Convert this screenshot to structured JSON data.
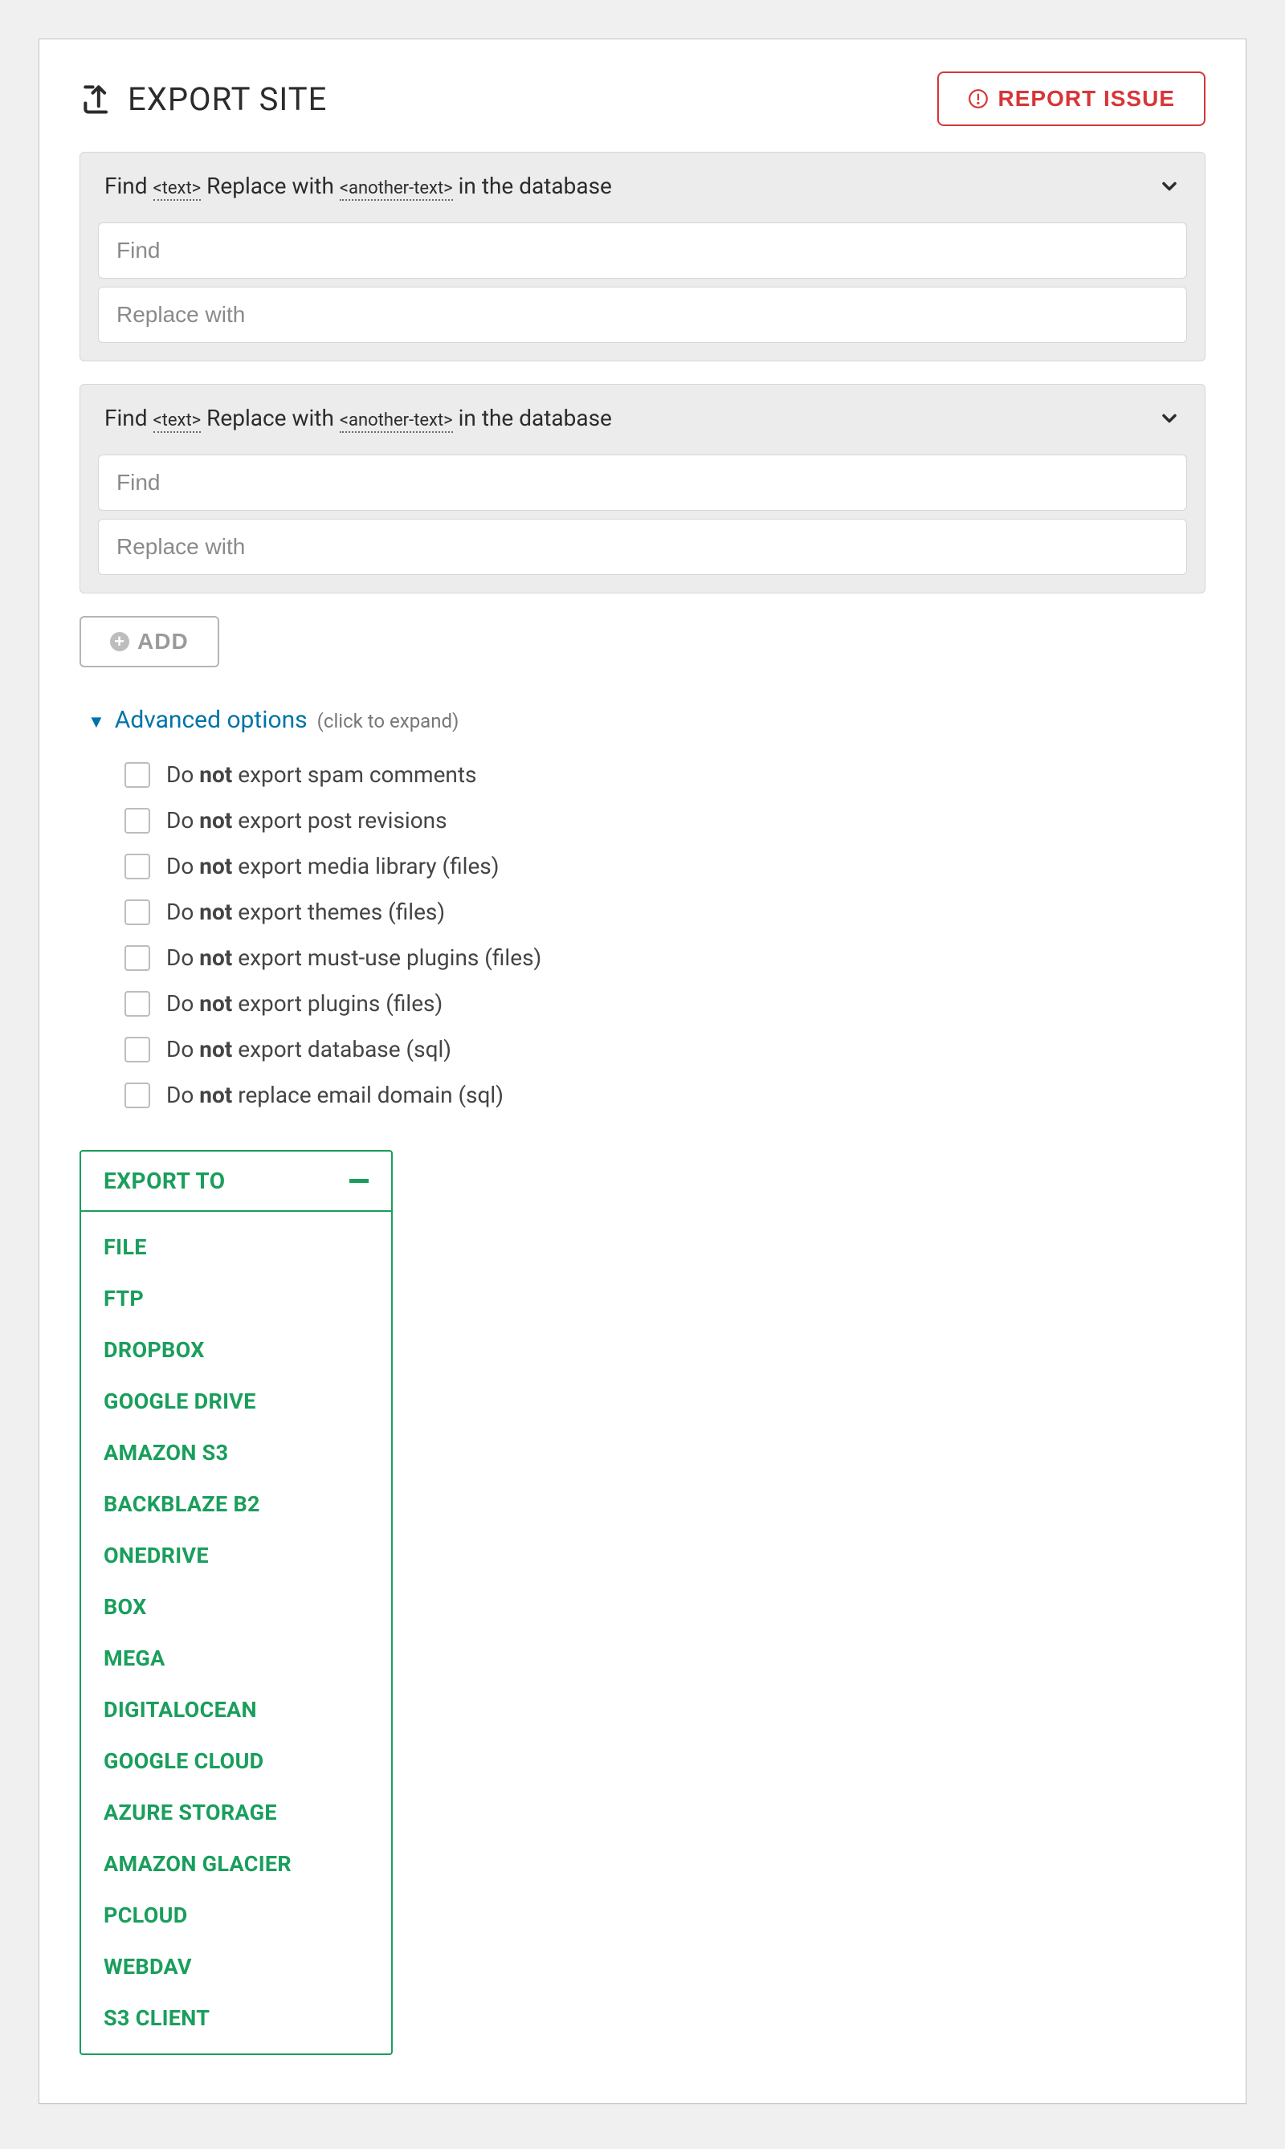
{
  "header": {
    "title": "EXPORT SITE",
    "report_label": "REPORT ISSUE"
  },
  "find_replace": {
    "header_find": "Find",
    "header_tag1": "<text>",
    "header_replace": "Replace with",
    "header_tag2": "<another-text>",
    "header_suffix": "in the database",
    "find_placeholder": "Find",
    "replace_placeholder": "Replace with"
  },
  "add_label": "ADD",
  "advanced": {
    "label": "Advanced options",
    "hint": "(click to expand)",
    "do_prefix": "Do",
    "not_word": "not",
    "items": [
      " export spam comments",
      " export post revisions",
      " export media library (files)",
      " export themes (files)",
      " export must-use plugins (files)",
      " export plugins (files)",
      " export database (sql)",
      " replace email domain (sql)"
    ]
  },
  "export": {
    "header": "EXPORT TO",
    "destinations": [
      "FILE",
      "FTP",
      "DROPBOX",
      "GOOGLE DRIVE",
      "AMAZON S3",
      "BACKBLAZE B2",
      "ONEDRIVE",
      "BOX",
      "MEGA",
      "DIGITALOCEAN",
      "GOOGLE CLOUD",
      "AZURE STORAGE",
      "AMAZON GLACIER",
      "PCLOUD",
      "WEBDAV",
      "S3 CLIENT"
    ]
  }
}
